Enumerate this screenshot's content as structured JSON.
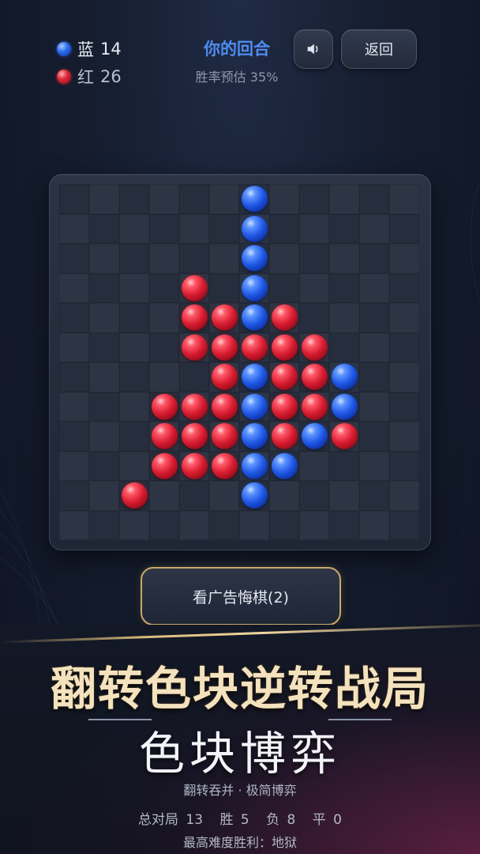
{
  "hud": {
    "blue_label": "蓝",
    "blue_score": "14",
    "red_label": "红",
    "red_score": "26",
    "turn_text": "你的回合",
    "winrate_text": "胜率预估 35%",
    "back_label": "返回",
    "sound_icon": "speaker-icon"
  },
  "board": {
    "size": 12,
    "legend": "B = blue piece, R = red piece, . = empty",
    "rows": [
      "......B.....",
      "......B.....",
      "......B.....",
      "....R.B.....",
      "....RRBR....",
      "....RRRRR...",
      ".....RBRRB..",
      "...RRRBRRB..",
      "...RRRBRBR..",
      "...RRRBB....",
      "..R...B.....",
      "............"
    ]
  },
  "undo_button": {
    "label": "看广告悔棋(2)"
  },
  "promo": {
    "headline": "翻转色块逆转战局",
    "title": "色块博弈",
    "tagline": "翻转吞并 · 极简博弈",
    "stats": {
      "total": "总对局 13",
      "wins": "胜 5",
      "losses": "负 8",
      "draws": "平 0"
    },
    "best": "最高难度胜利：地狱"
  },
  "colors": {
    "blue": "#2f6ff0",
    "red": "#e0283a",
    "gold": "#c9a86a",
    "turn": "#4f8cf0"
  }
}
